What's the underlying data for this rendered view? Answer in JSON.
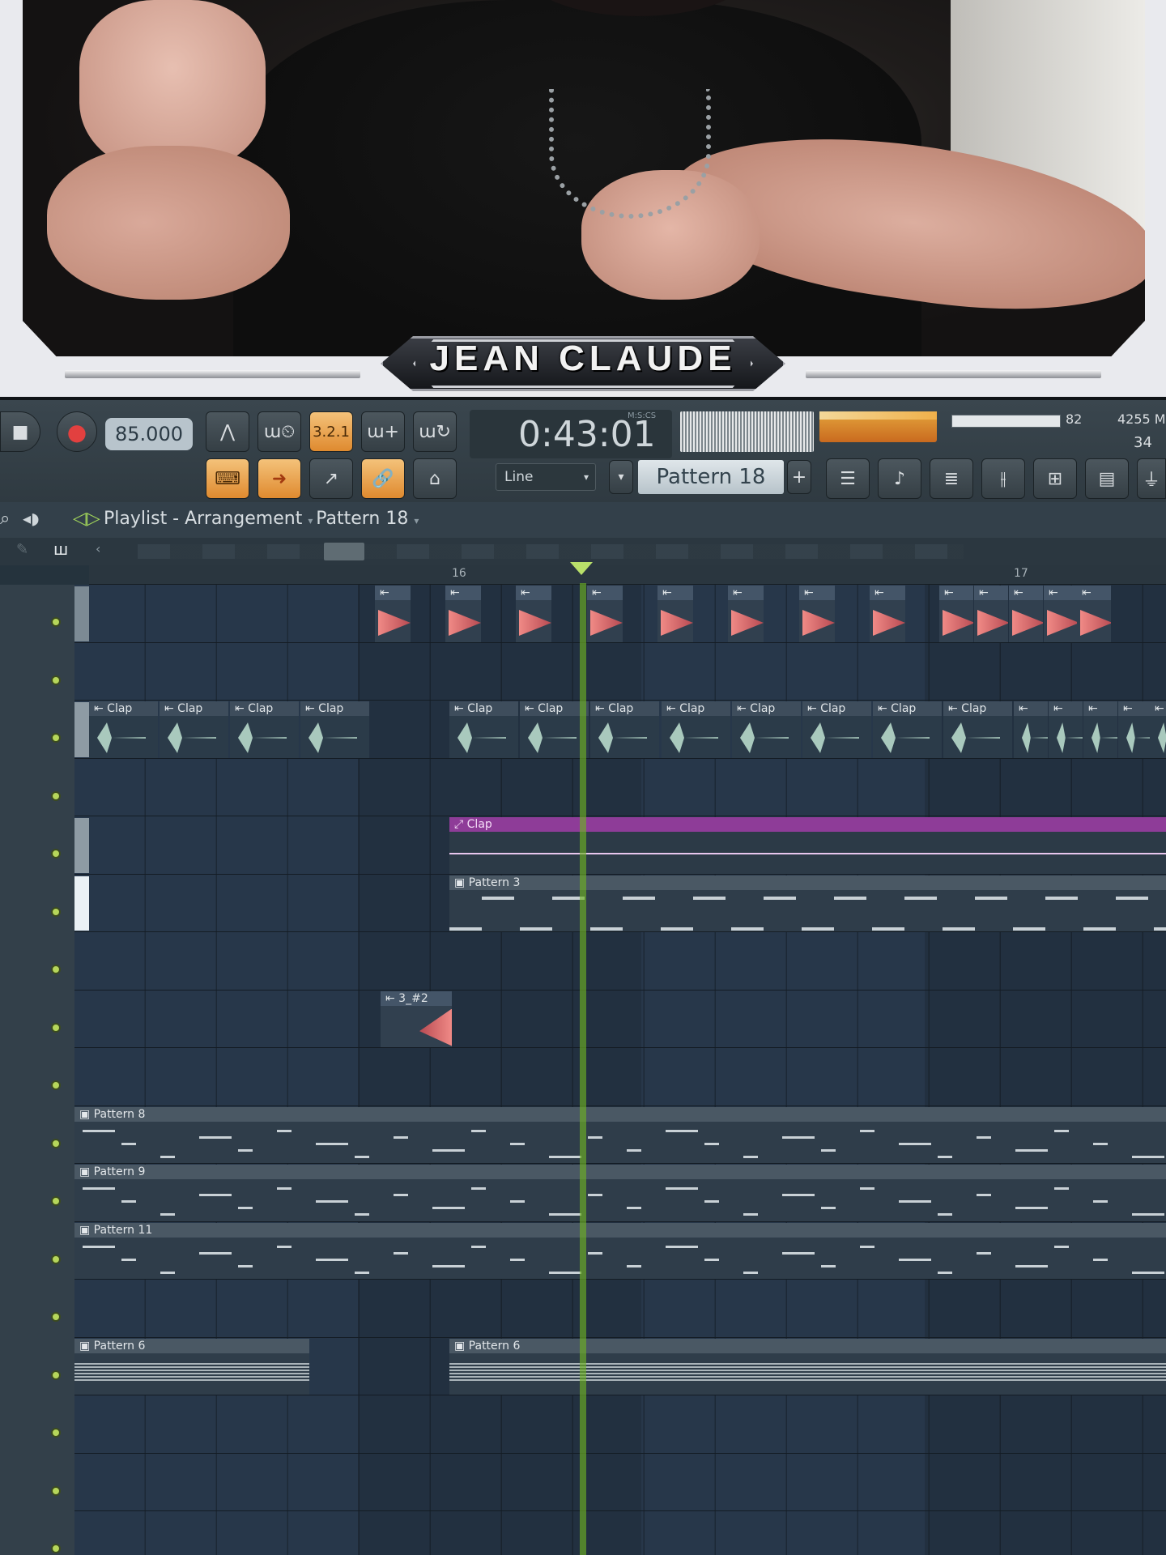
{
  "webcam": {
    "streamer_name": "JEAN CLAUDE"
  },
  "transport": {
    "tempo": "85.000",
    "time": "0:43:01",
    "time_label": "M:S:CS",
    "cpu": "82",
    "memory": "4255 M",
    "polyphony": "34"
  },
  "toolbar": {
    "snap_value": "Line",
    "pattern_value": "Pattern 18",
    "countdown_label": "3.2.1"
  },
  "playlist": {
    "title": "Playlist - Arrangement",
    "breadcrumb_separator": "›",
    "pattern": "Pattern 18",
    "ruler": [
      "16",
      "17"
    ],
    "clips": {
      "clap": "Clap",
      "auto_clap": "Clap",
      "pattern3": "Pattern 3",
      "sample_3_2": "3_#2",
      "pattern8": "Pattern 8",
      "pattern9": "Pattern 9",
      "pattern11": "Pattern 11",
      "pattern6": "Pattern 6"
    }
  },
  "colors": {
    "accent": "#df8a2f",
    "playhead": "#6db024",
    "automation": "#8e3c98",
    "kick": "#f08a86",
    "clap_wave": "#a9c9bd"
  }
}
